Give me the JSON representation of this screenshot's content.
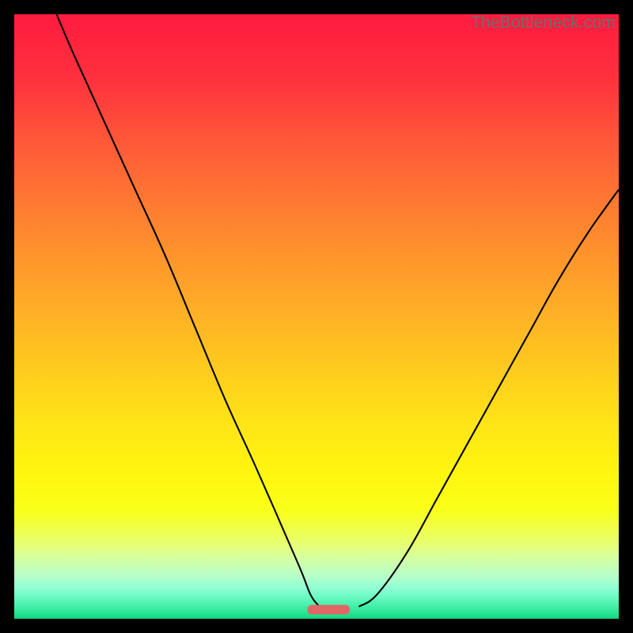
{
  "watermark": "TheBottleneck.com",
  "colors": {
    "frame_background": "#000000",
    "curve_stroke": "#000000",
    "optimum_marker": "#e26666"
  },
  "chart_data": {
    "type": "line",
    "title": "",
    "xlabel": "",
    "ylabel": "",
    "xlim": [
      0,
      100
    ],
    "ylim": [
      0,
      100
    ],
    "series": [
      {
        "name": "left-curve",
        "x": [
          7,
          10,
          15,
          20,
          25,
          30,
          35,
          40,
          47,
          49,
          50.5
        ],
        "values": [
          100,
          93,
          82,
          71,
          60,
          48,
          36,
          25,
          9,
          4,
          2
        ]
      },
      {
        "name": "right-curve",
        "x": [
          57,
          60,
          65,
          70,
          75,
          80,
          85,
          90,
          95,
          100
        ],
        "values": [
          2,
          4,
          11,
          20,
          29,
          38,
          47,
          56,
          64,
          71
        ]
      }
    ],
    "optimum_marker": {
      "x": 52,
      "width": 7,
      "y": 1.5
    }
  }
}
